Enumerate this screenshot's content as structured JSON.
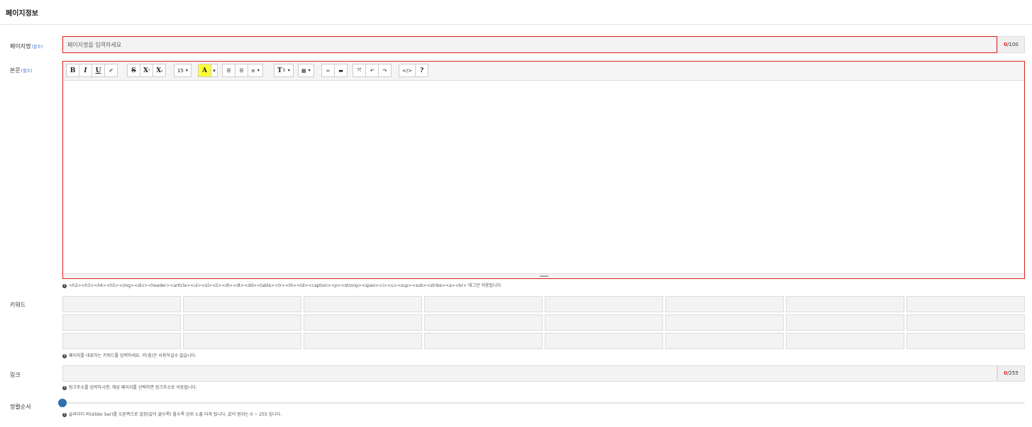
{
  "header": {
    "title": "페이지정보"
  },
  "page_name": {
    "label": "페이지명",
    "required": "(필수)",
    "placeholder": "페이지명을 입력하세요",
    "count": "0",
    "max": "/100"
  },
  "body": {
    "label": "본문",
    "required": "(필수)",
    "toolbar": {
      "bold": "B",
      "italic": "I",
      "underline": "U",
      "eraser": "✐",
      "strike": "S",
      "superscript": "X",
      "subscript": "X",
      "fontsize": "15",
      "color": "A",
      "ul": "☰",
      "ol": "☰",
      "align": "≡",
      "style": "T",
      "table": "▦",
      "link": "∞",
      "hr": "▬",
      "fullscreen": "⤧",
      "undo": "↶",
      "redo": "↷",
      "code": "</>",
      "help": "?"
    },
    "help": "<h2><h3><h4><h5><img><div><header><article><ul><ol><li><dl><dt><dd><table><tr><th><td><caption><p><strong><span><i><u><sup><sub><strike><a><br> 태그만 허용됩니다."
  },
  "keyword": {
    "label": "키워드",
    "help": "페이지를 대표하는 키워드를 입력하세요. 키(쉼)은 사용하실수 없습니다."
  },
  "link": {
    "label": "링크",
    "count": "0",
    "max": "/255",
    "help": "링크주소를 입력하시면, 해당 페이지를 선택하면 링크주소로 이동됩니다."
  },
  "sort": {
    "label": "정렬순서",
    "value_fraction": 0,
    "help": "슬라이더 바(slider bar)를 오른쪽으로 설정(값이 클수록) 할수록 상위 노출 되게 됩니다. 값의 범위는 0 ~ 255 입니다."
  },
  "colors": {
    "required_border": "#e02020",
    "accent": "#2f6fb0",
    "required_tag": "#3a6fd8"
  }
}
